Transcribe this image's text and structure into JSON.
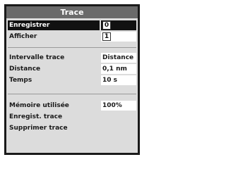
{
  "menu": {
    "title": "Trace",
    "record_label": "Enregistrer",
    "record_value": "0",
    "display_label": "Afficher",
    "display_value": "1",
    "interval_label": "Intervalle trace",
    "interval_value": "Distance",
    "distance_label": "Distance",
    "distance_value": "0,1 nm",
    "time_label": "Temps",
    "time_value": "10 s",
    "memory_label": "Mémoire utilisée",
    "memory_value": "100%",
    "save_label": "Enregist. trace",
    "delete_label": "Supprimer trace"
  }
}
